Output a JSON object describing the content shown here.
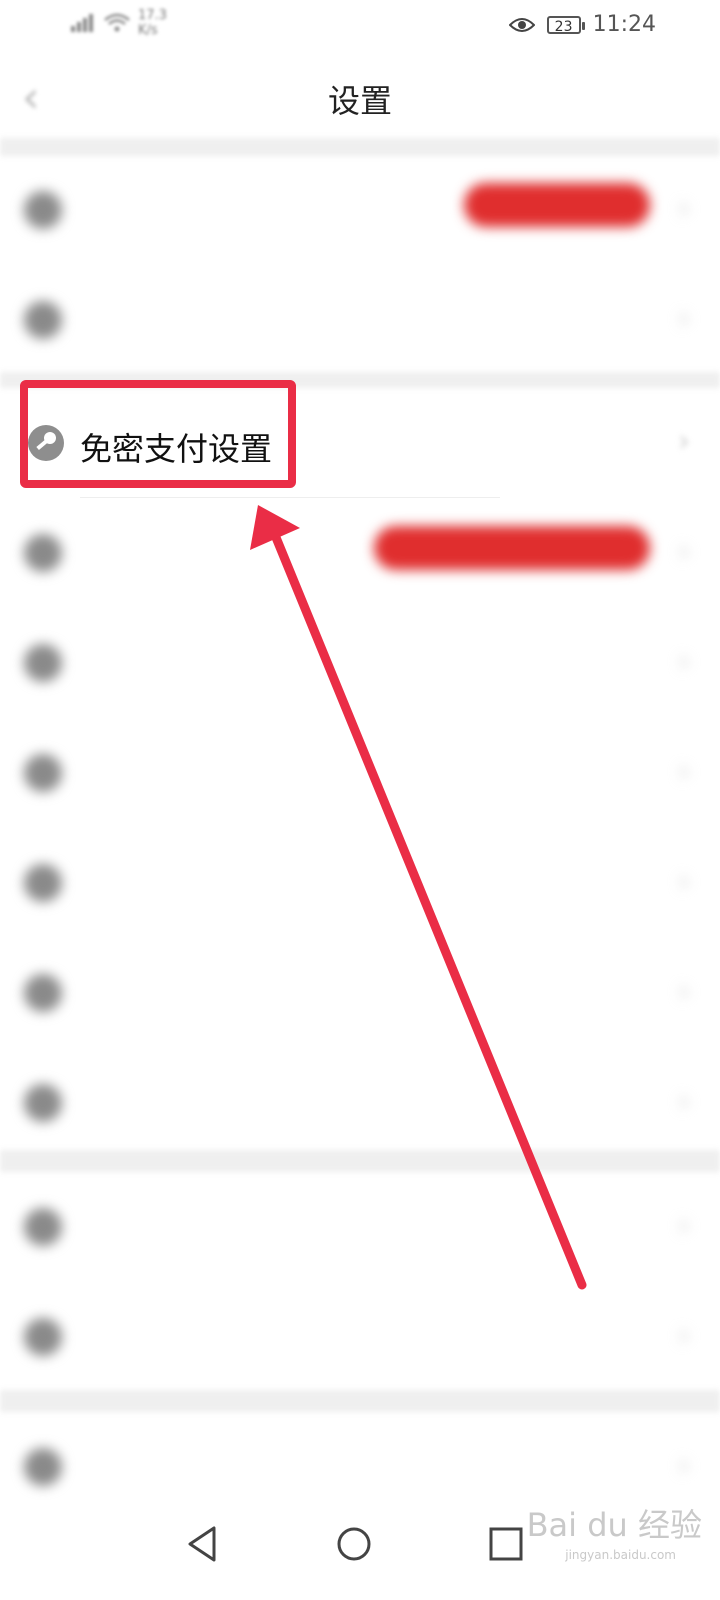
{
  "status_bar": {
    "speed_value": "17.3",
    "speed_unit": "K/s",
    "battery": "23",
    "time": "11:24"
  },
  "header": {
    "title": "设置"
  },
  "rows": [
    {
      "label": "",
      "pill": ""
    },
    {
      "label": ""
    },
    {
      "label": "免密支付设置"
    },
    {
      "label": "",
      "pill": ""
    },
    {
      "label": "",
      "right_text": ""
    },
    {
      "label": ""
    },
    {
      "label": ""
    },
    {
      "label": ""
    },
    {
      "label": ""
    },
    {
      "label": ""
    },
    {
      "label": ""
    },
    {
      "label": ""
    }
  ],
  "watermark": {
    "text": "Bai du 经验",
    "sub": "jingyan.baidu.com"
  },
  "colors": {
    "highlight": "#ea2d46",
    "pill": "#e02e2e",
    "separator": "#efefef"
  },
  "icons": [
    "back-icon",
    "wifi-icon",
    "signal-icon",
    "eye-icon",
    "battery-icon",
    "key-icon",
    "nav-back-icon",
    "nav-home-icon",
    "nav-recent-icon",
    "annotation-arrow"
  ]
}
